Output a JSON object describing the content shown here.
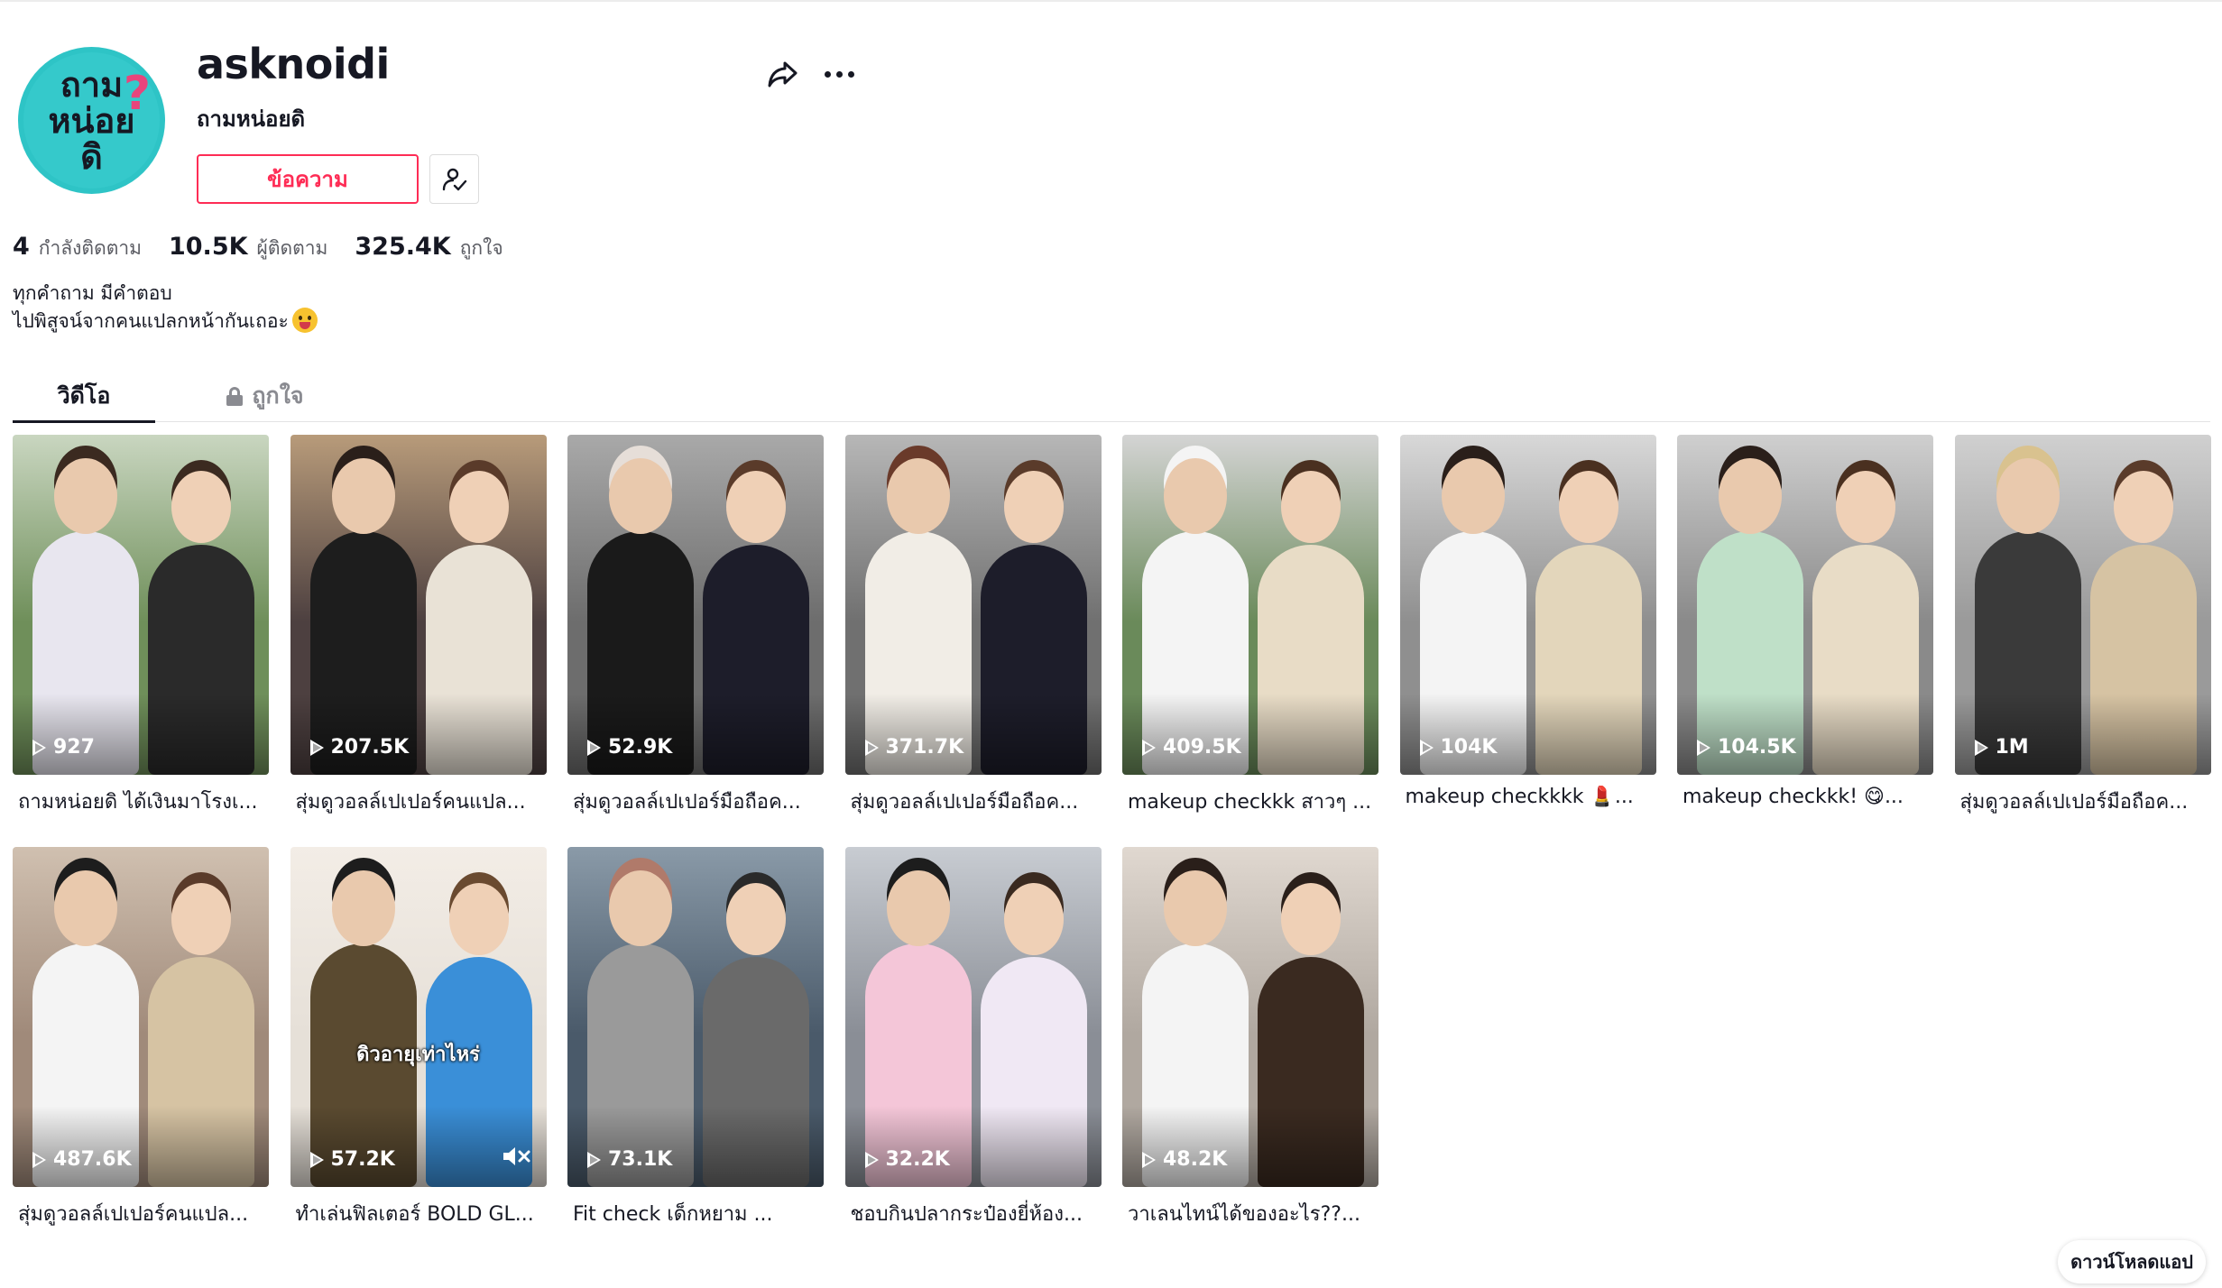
{
  "profile": {
    "username": "asknoidi",
    "nickname": "ถามหน่อยดิ",
    "avatar_logo_text": [
      "ถาม",
      "หน่อย",
      "ดิ"
    ],
    "message_button": "ข้อความ",
    "stats": {
      "following_count": "4",
      "following_label": "กำลังติดตาม",
      "followers_count": "10.5K",
      "followers_label": "ผู้ติดตาม",
      "likes_count": "325.4K",
      "likes_label": "ถูกใจ"
    },
    "bio_line1": "ทุกคำถาม มีคำตอบ",
    "bio_line2": "ไปพิสูจน์จากคนแปลกหน้ากันเถอะ"
  },
  "tabs": {
    "videos": "วิดีโอ",
    "liked": "ถูกใจ"
  },
  "videos": [
    {
      "views": "927",
      "caption": "ถามหน่อยดิ ได้เงินมาโรงเ..."
    },
    {
      "views": "207.5K",
      "caption": "สุ่มดูวอลล์เปเปอร์คนแปล..."
    },
    {
      "views": "52.9K",
      "caption": "สุ่มดูวอลล์เปเปอร์มือถือค..."
    },
    {
      "views": "371.7K",
      "caption": "สุ่มดูวอลล์เปเปอร์มือถือค..."
    },
    {
      "views": "409.5K",
      "caption": "makeup checkkk สาวๆ ..."
    },
    {
      "views": "104K",
      "caption": "makeup checkkkk 💄..."
    },
    {
      "views": "104.5K",
      "caption": "makeup checkkk! 😋..."
    },
    {
      "views": "1M",
      "caption": "สุ่มดูวอลล์เปเปอร์มือถือค..."
    },
    {
      "views": "487.6K",
      "caption": "สุ่มดูวอลล์เปเปอร์คนแปล..."
    },
    {
      "views": "57.2K",
      "caption": "ทำเล่นฟิลเตอร์ BOLD GL...",
      "overlay": "ดิวอายุเท่าไหร่"
    },
    {
      "views": "73.1K",
      "caption": "Fit check เด็กหยาม ..."
    },
    {
      "views": "32.2K",
      "caption": "ชอบกินปลากระป๋องยี่ห้อง..."
    },
    {
      "views": "48.2K",
      "caption": "วาเลนไทน์ได้ของอะไร??..."
    }
  ],
  "download_app": "ดาวน์โหลดแอป",
  "colors": {
    "accent": "#fe2c55",
    "avatar_bg": "#2ec4c6"
  }
}
